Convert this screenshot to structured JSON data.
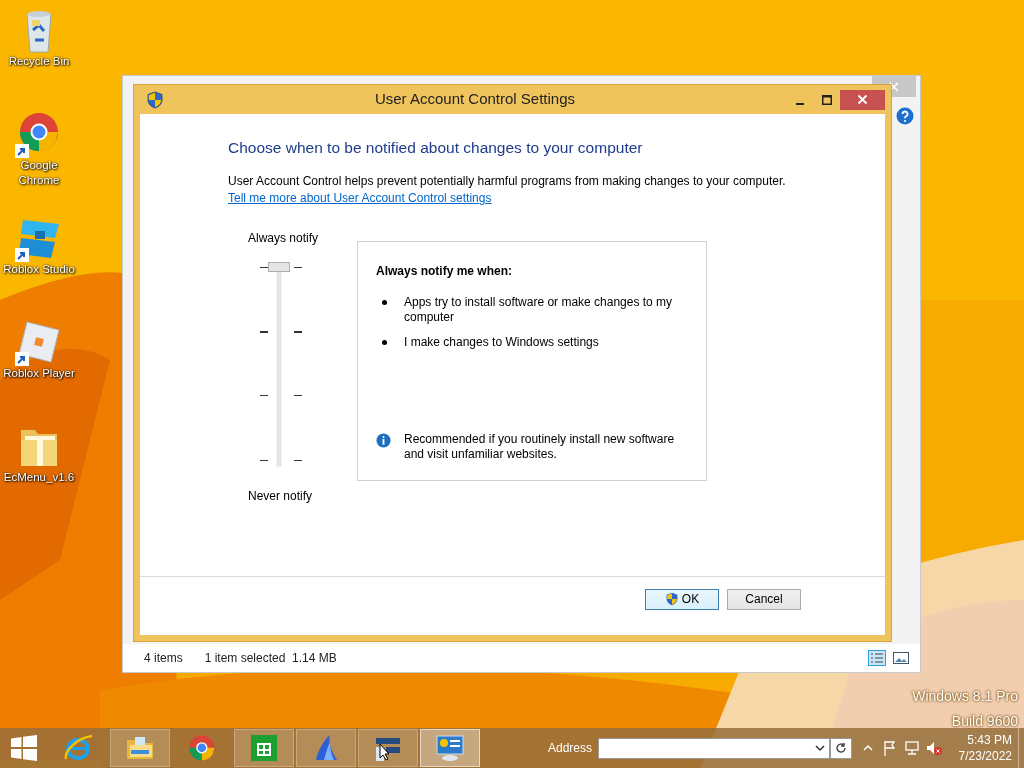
{
  "desktop_icons": [
    {
      "label": "Recycle Bin",
      "kind": "recycle",
      "shortcut": false
    },
    {
      "label": "Google Chrome",
      "kind": "chrome",
      "shortcut": true
    },
    {
      "label": "Roblox Studio",
      "kind": "studio",
      "shortcut": true
    },
    {
      "label": "Roblox Player",
      "kind": "player",
      "shortcut": true
    },
    {
      "label": "EcMenu_v1.6",
      "kind": "folder",
      "shortcut": false
    }
  ],
  "explorer": {
    "status_items": "4 items",
    "status_selection": "1 item selected",
    "status_size": "1.14 MB"
  },
  "dialog": {
    "title": "User Account Control Settings",
    "heading": "Choose when to be notified about changes to your computer",
    "description": "User Account Control helps prevent potentially harmful programs from making changes to your computer.",
    "link": "Tell me more about User Account Control settings",
    "slider": {
      "top_label": "Always notify",
      "bottom_label": "Never notify",
      "level": 1
    },
    "info": {
      "heading": "Always notify me when:",
      "bullets": [
        "Apps try to install software or make changes to my computer",
        "I make changes to Windows settings"
      ],
      "note": "Recommended if you routinely install new software and visit unfamiliar websites."
    },
    "buttons": [
      {
        "label": "OK",
        "shield": true
      },
      {
        "label": "Cancel",
        "shield": false
      }
    ]
  },
  "watermark": [
    "Windows 8.1 Pro",
    "Build 9600"
  ],
  "taskbar": {
    "apps": [
      {
        "kind": "ie",
        "running": false,
        "selected": false
      },
      {
        "kind": "explorer",
        "running": true,
        "selected": false
      },
      {
        "kind": "chrome",
        "running": false,
        "selected": false
      },
      {
        "kind": "store",
        "running": true,
        "selected": false
      },
      {
        "kind": "sail",
        "running": true,
        "selected": false
      },
      {
        "kind": "pointer",
        "running": true,
        "selected": false
      },
      {
        "kind": "panel",
        "running": true,
        "selected": true
      }
    ],
    "address_label": "Address",
    "clock_time": "5:43 PM",
    "clock_date": "7/23/2022"
  }
}
